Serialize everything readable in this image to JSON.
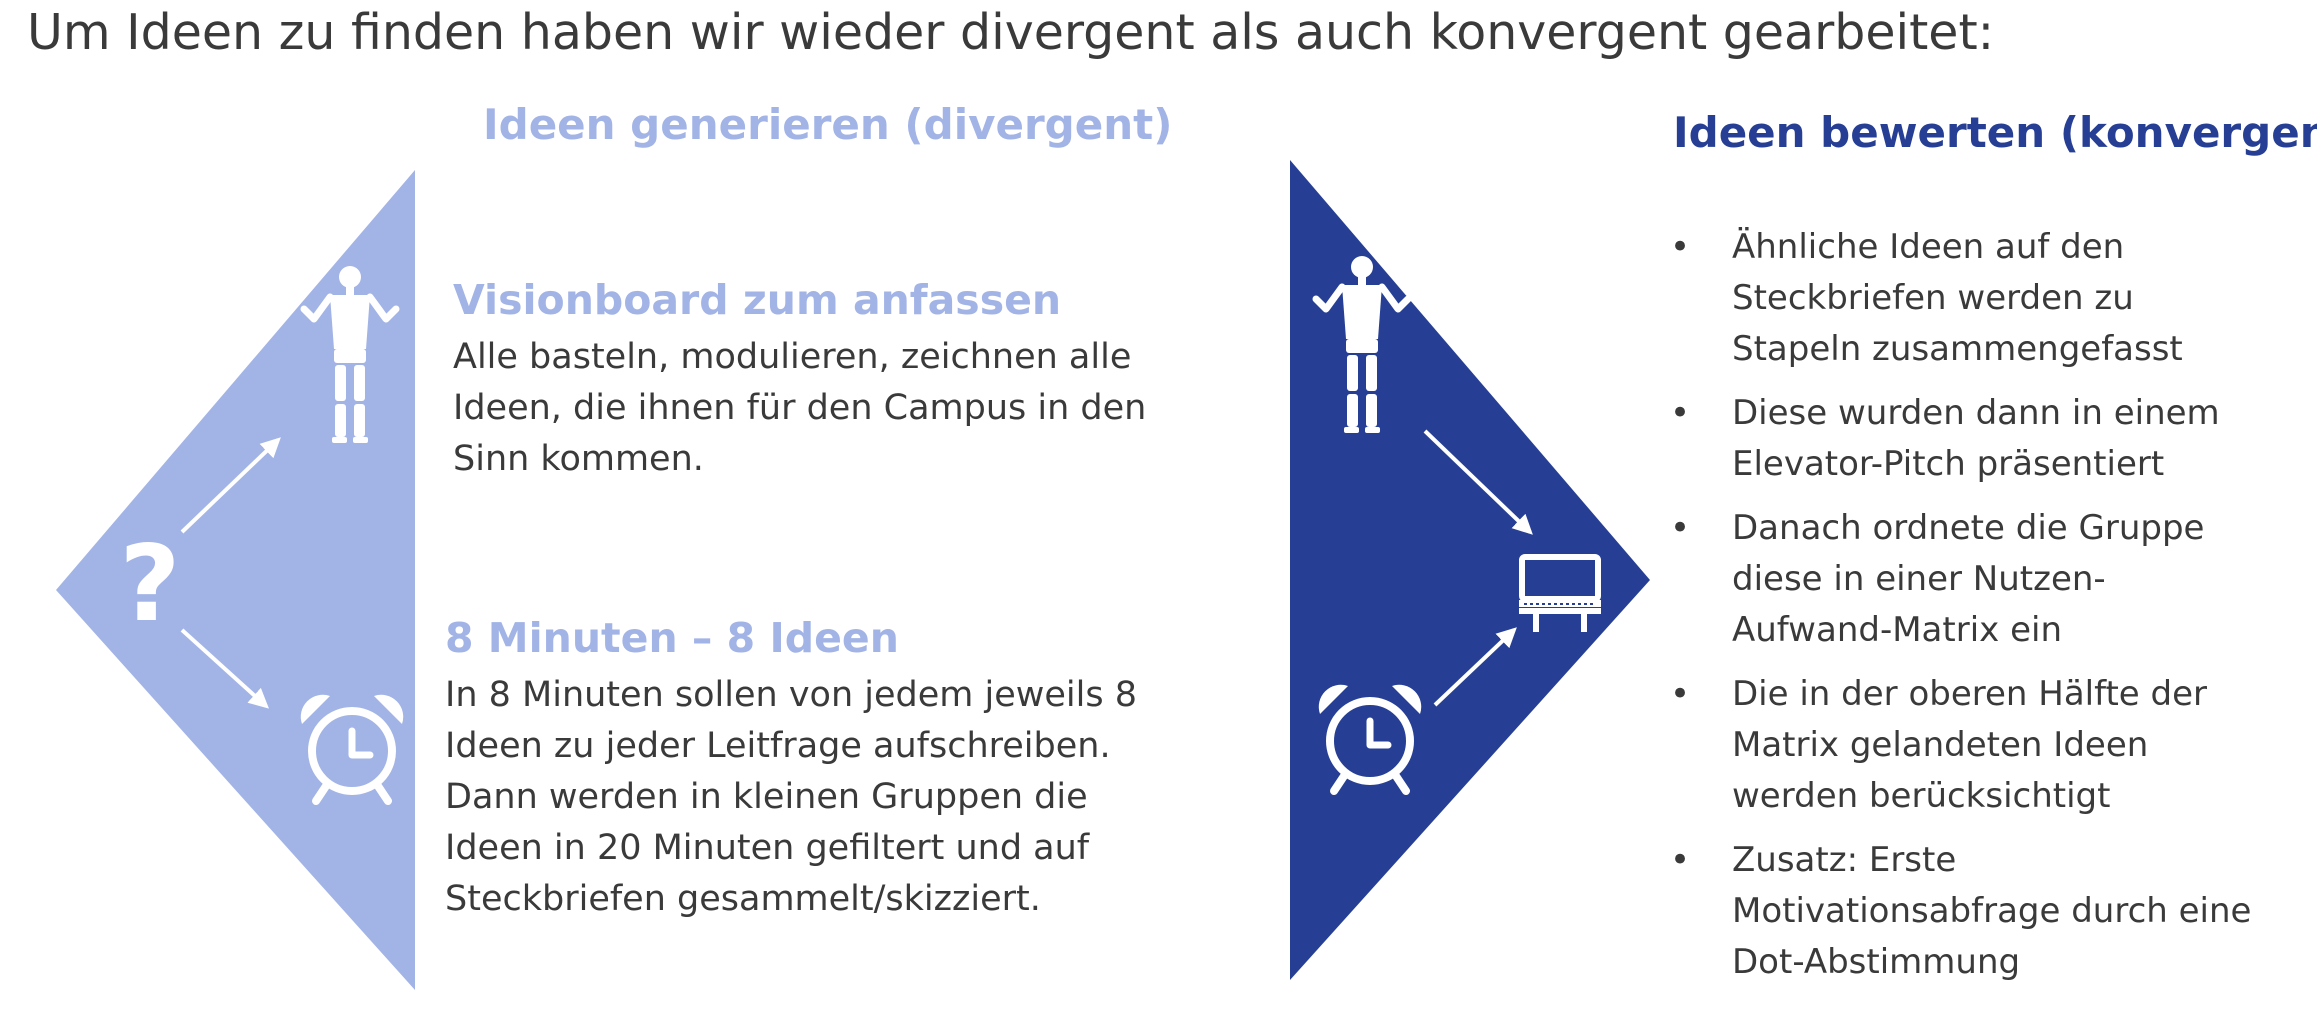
{
  "title": "Um Ideen zu finden haben wir wieder divergent als auch konvergent gearbeitet:",
  "colors": {
    "divergent": "#a2b3e6",
    "convergent": "#263f94",
    "text": "#3a3a3a",
    "icon": "#ffffff"
  },
  "left": {
    "heading": "Ideen generieren (divergent)",
    "icons": [
      "question-mark-icon",
      "person-icon",
      "alarm-clock-icon",
      "arrow-icon"
    ],
    "blocks": [
      {
        "title": "Visionboard zum anfassen",
        "lines": [
          "Alle basteln, modulieren, zeichnen alle",
          "Ideen, die ihnen für den Campus in den",
          "Sinn kommen."
        ]
      },
      {
        "title": "8 Minuten – 8 Ideen",
        "lines": [
          "In 8 Minuten sollen von jedem jeweils 8",
          "Ideen zu jeder Leitfrage aufschreiben.",
          "Dann werden in kleinen Gruppen die",
          "Ideen in 20 Minuten gefiltert und auf",
          "Steckbriefen gesammelt/skizziert."
        ]
      }
    ]
  },
  "right": {
    "heading": "Ideen bewerten (konvergent)",
    "icons": [
      "person-icon",
      "alarm-clock-icon",
      "billboard-icon",
      "arrow-icon"
    ],
    "bullets": [
      {
        "lines": [
          "Ähnliche Ideen auf den",
          "Steckbriefen werden zu",
          "Stapeln zusammengefasst"
        ]
      },
      {
        "lines": [
          "Diese wurden dann in einem",
          "Elevator-Pitch präsentiert"
        ]
      },
      {
        "lines": [
          "Danach ordnete die Gruppe",
          "diese in einer Nutzen-",
          "Aufwand-Matrix ein"
        ]
      },
      {
        "lines": [
          "Die in der oberen Hälfte der",
          "Matrix gelandeten Ideen",
          "werden berücksichtigt"
        ]
      },
      {
        "lines": [
          "Zusatz: Erste",
          "Motivationsabfrage durch eine",
          "Dot-Abstimmung"
        ]
      }
    ]
  }
}
